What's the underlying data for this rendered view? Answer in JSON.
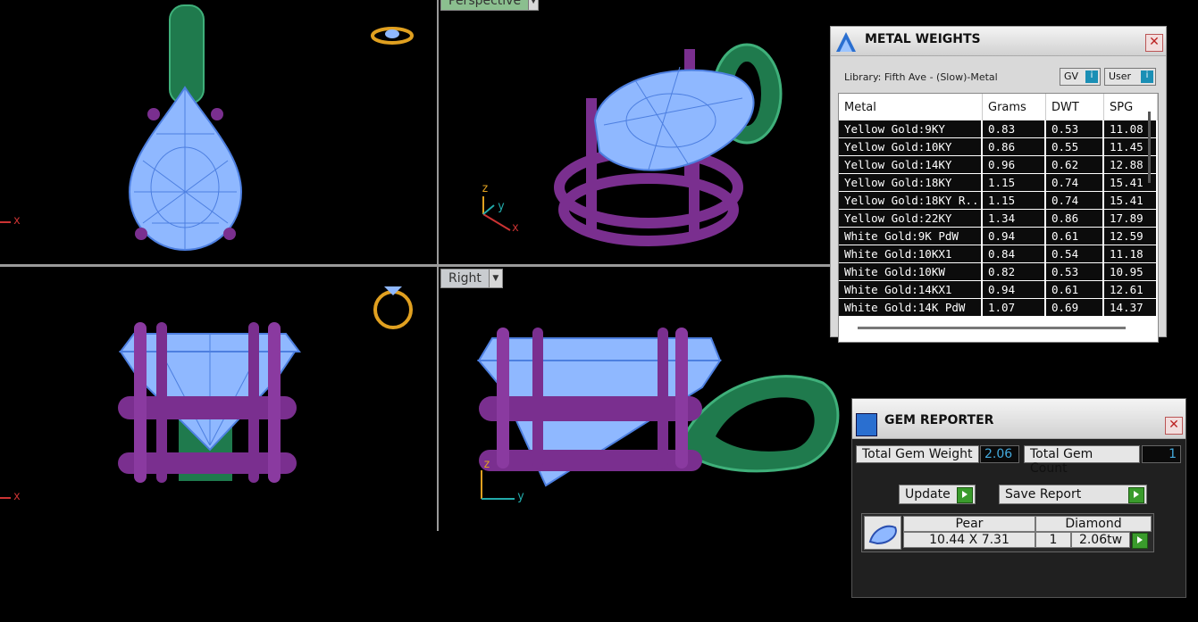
{
  "viewports": {
    "perspective_label": "Perspective",
    "right_label": "Right",
    "axis": {
      "x": "x",
      "y": "y",
      "z": "z"
    }
  },
  "metal_weights": {
    "title": "METAL WEIGHTS",
    "library": "Library: Fifth Ave - (Slow)-Metal",
    "gv_label": "GV",
    "user_label": "User",
    "columns": [
      "Metal",
      "Grams",
      "DWT",
      "SPG"
    ],
    "rows": [
      [
        "Yellow Gold:9KY",
        "0.83",
        "0.53",
        "11.08"
      ],
      [
        "Yellow Gold:10KY",
        "0.86",
        "0.55",
        "11.45"
      ],
      [
        "Yellow Gold:14KY",
        "0.96",
        "0.62",
        "12.88"
      ],
      [
        "Yellow Gold:18KY",
        "1.15",
        "0.74",
        "15.41"
      ],
      [
        "Yellow Gold:18KY R...",
        "1.15",
        "0.74",
        "15.41"
      ],
      [
        "Yellow Gold:22KY",
        "1.34",
        "0.86",
        "17.89"
      ],
      [
        "White Gold:9K PdW",
        "0.94",
        "0.61",
        "12.59"
      ],
      [
        "White Gold:10KX1",
        "0.84",
        "0.54",
        "11.18"
      ],
      [
        "White Gold:10KW",
        "0.82",
        "0.53",
        "10.95"
      ],
      [
        "White Gold:14KX1",
        "0.94",
        "0.61",
        "12.61"
      ],
      [
        "White Gold:14K PdW",
        "1.07",
        "0.69",
        "14.37"
      ]
    ],
    "close": "✕"
  },
  "gem_reporter": {
    "title": "GEM REPORTER",
    "close": "✕",
    "total_weight_label": "Total Gem Weight",
    "total_weight_value": "2.06",
    "total_count_label": "Total Gem Count",
    "total_count_value": "1",
    "update_label": "Update",
    "save_label": "Save Report",
    "gem": {
      "shape": "Pear",
      "type": "Diamond",
      "size": "10.44 X 7.31",
      "count": "1",
      "weight": "2.06tw"
    }
  },
  "colors": {
    "stone": "#8fb8ff",
    "prong": "#7a2f8f",
    "bail": "#1f7a4d",
    "ring_icon": "#e0a020"
  }
}
